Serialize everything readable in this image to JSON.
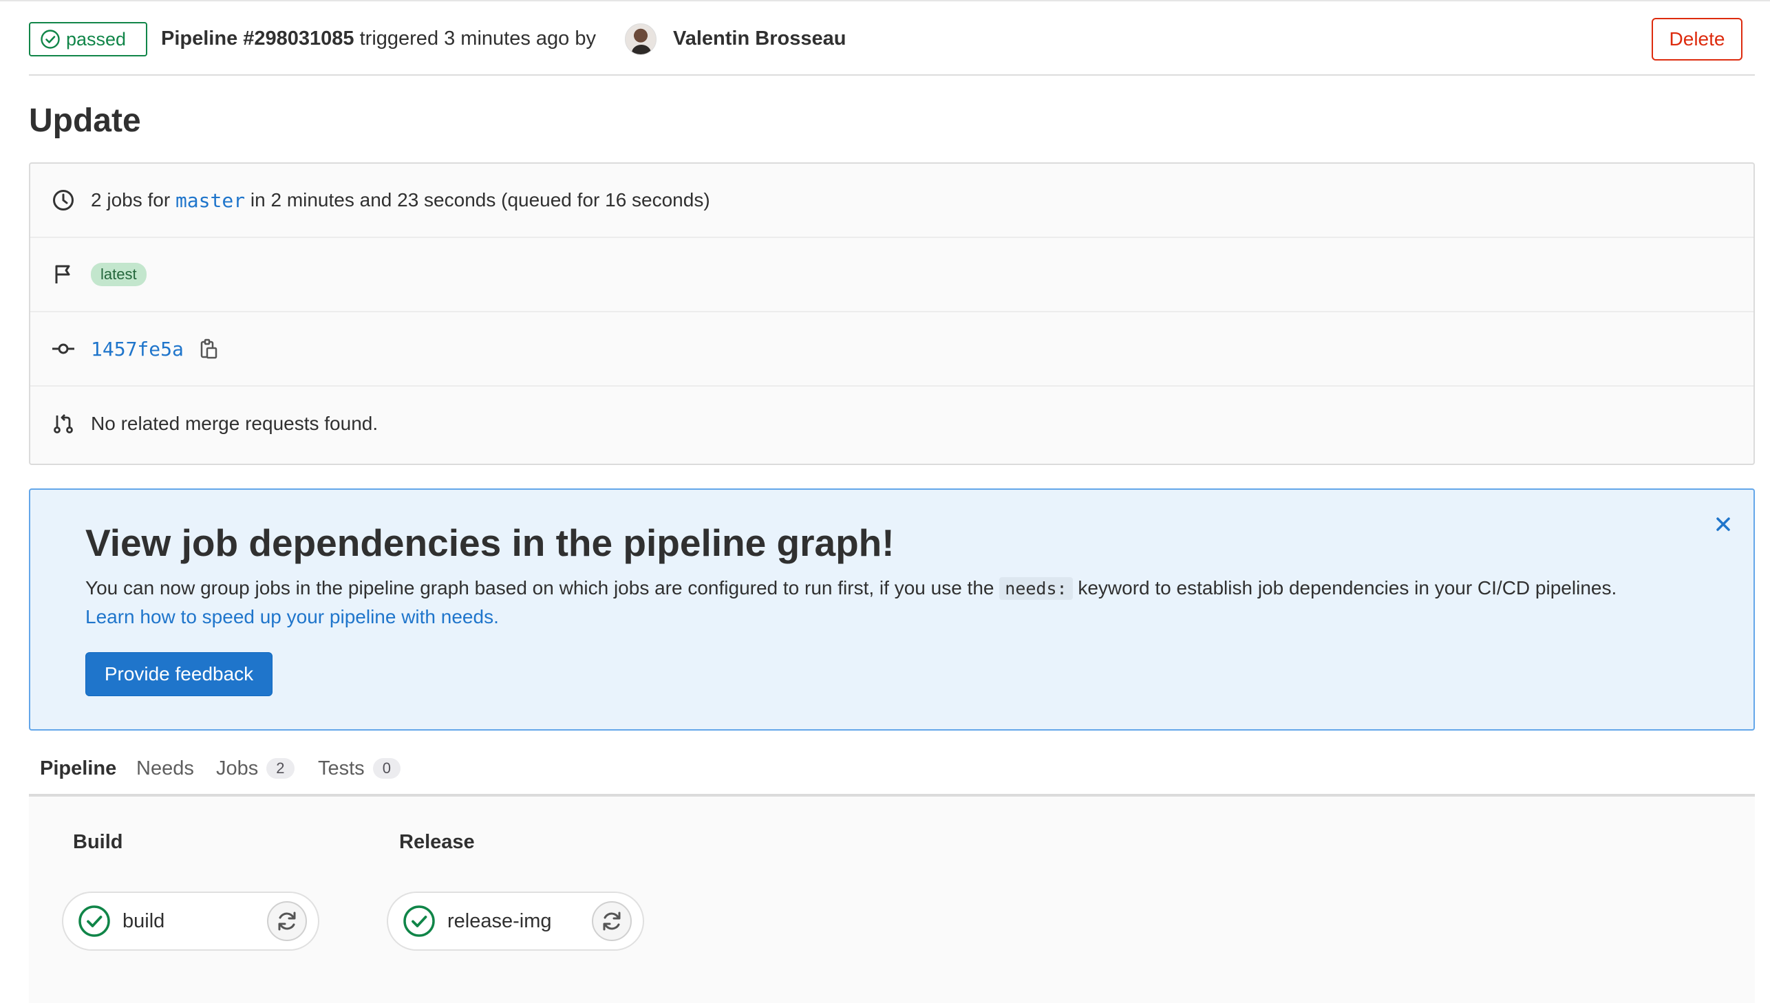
{
  "header": {
    "status": "passed",
    "pipeline_label": "Pipeline #298031085",
    "triggered_text": "triggered 3 minutes ago by",
    "author": "Valentin Brosseau",
    "delete_label": "Delete"
  },
  "page_title": "Update",
  "info": {
    "jobs_prefix": "2 jobs for",
    "branch": "master",
    "jobs_suffix": "in 2 minutes and 23 seconds (queued for 16 seconds)",
    "tag": "latest",
    "commit_sha": "1457fe5a",
    "merge_requests": "No related merge requests found."
  },
  "alert": {
    "title": "View job dependencies in the pipeline graph!",
    "body_prefix": "You can now group jobs in the pipeline graph based on which jobs are configured to run first, if you use the",
    "body_code": "needs:",
    "body_suffix": "keyword to establish job dependencies in your CI/CD pipelines.",
    "link": "Learn how to speed up your pipeline with needs.",
    "button": "Provide feedback"
  },
  "tabs": [
    {
      "label": "Pipeline",
      "active": true
    },
    {
      "label": "Needs"
    },
    {
      "label": "Jobs",
      "count": "2"
    },
    {
      "label": "Tests",
      "count": "0"
    }
  ],
  "stages": [
    {
      "name": "Build",
      "jobs": [
        {
          "name": "build",
          "status": "passed"
        }
      ]
    },
    {
      "name": "Release",
      "jobs": [
        {
          "name": "release-img",
          "status": "passed"
        }
      ]
    }
  ],
  "colors": {
    "success": "#108548",
    "danger": "#dd2b0e",
    "link": "#1f75cb",
    "alert_bg": "#e9f3fc",
    "tab_active_underline": "#6666c4"
  }
}
